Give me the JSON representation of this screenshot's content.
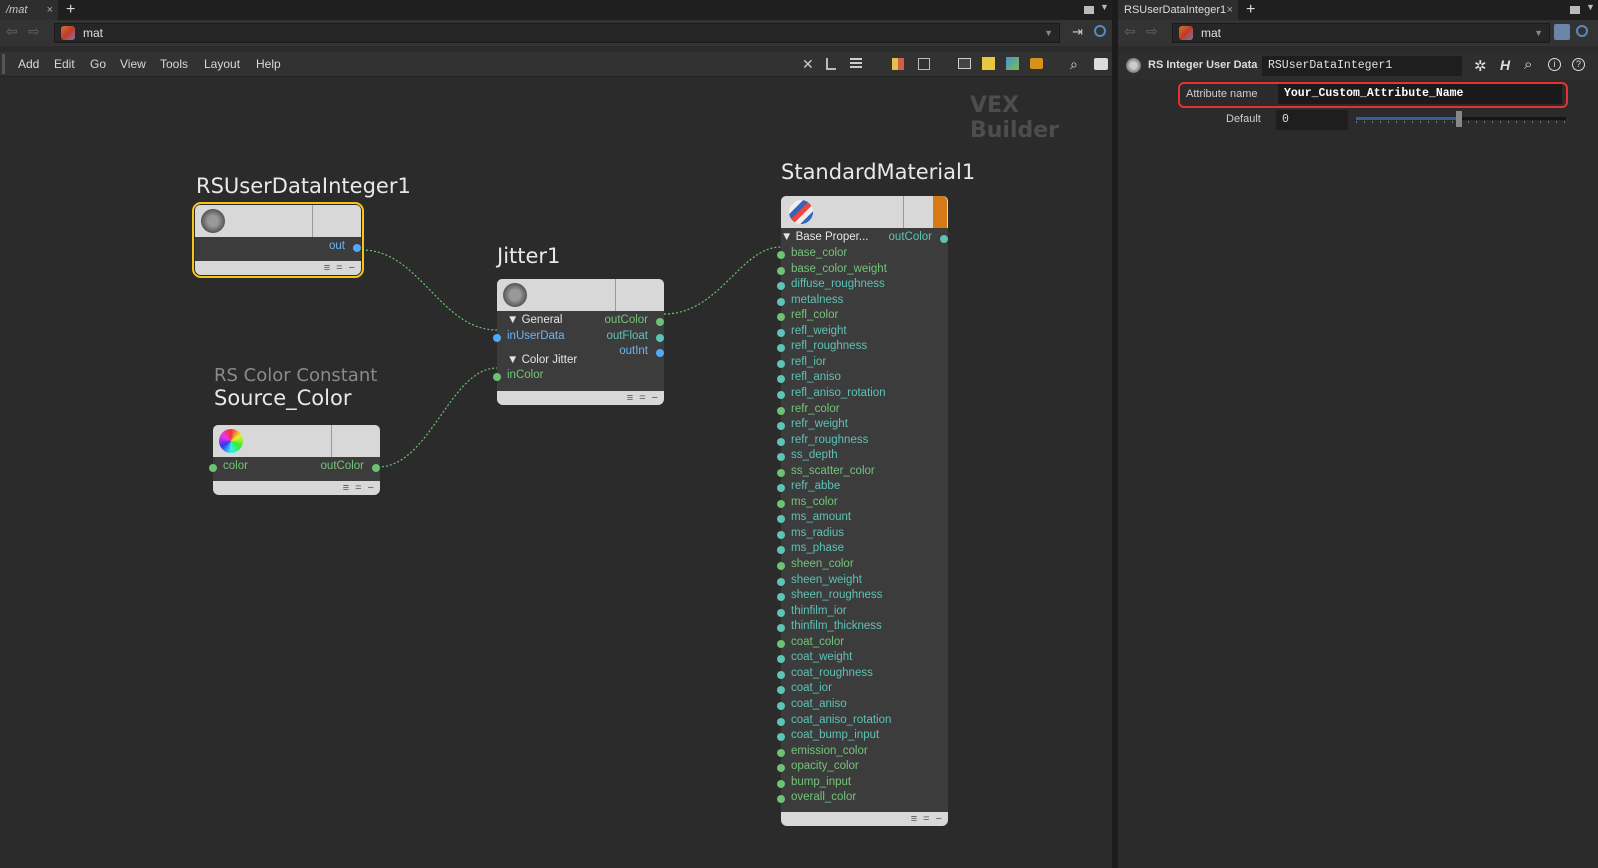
{
  "left": {
    "tab_label": "/mat",
    "path": "mat",
    "menu": [
      "Add",
      "Edit",
      "Go",
      "View",
      "Tools",
      "Layout",
      "Help"
    ],
    "watermark": "VEX Builder",
    "nodes": {
      "userdata": {
        "title": "RSUserDataInteger1",
        "out": "out"
      },
      "jitter": {
        "title": "Jitter1",
        "section_general": "General",
        "in_userdata": "inUserData",
        "out_color": "outColor",
        "out_float": "outFloat",
        "out_int": "outInt",
        "section_color_jitter": "Color Jitter",
        "in_color": "inColor"
      },
      "source": {
        "type_label": "RS Color Constant",
        "title": "Source_Color",
        "in_color": "color",
        "out_color": "outColor"
      },
      "material": {
        "title": "StandardMaterial1",
        "section": "Base Proper...",
        "out_color": "outColor",
        "inputs": [
          "base_color",
          "base_color_weight",
          "diffuse_roughness",
          "metalness",
          "refl_color",
          "refl_weight",
          "refl_roughness",
          "refl_ior",
          "refl_aniso",
          "refl_aniso_rotation",
          "refr_color",
          "refr_weight",
          "refr_roughness",
          "ss_depth",
          "ss_scatter_color",
          "refr_abbe",
          "ms_color",
          "ms_amount",
          "ms_radius",
          "ms_phase",
          "sheen_color",
          "sheen_weight",
          "sheen_roughness",
          "thinfilm_ior",
          "thinfilm_thickness",
          "coat_color",
          "coat_weight",
          "coat_roughness",
          "coat_ior",
          "coat_aniso",
          "coat_aniso_rotation",
          "coat_bump_input",
          "emission_color",
          "opacity_color",
          "bump_input",
          "overall_color"
        ],
        "input_colors": [
          "g",
          "g",
          "t",
          "t",
          "g",
          "t",
          "t",
          "t",
          "t",
          "t",
          "g",
          "t",
          "t",
          "t",
          "g",
          "t",
          "g",
          "t",
          "t",
          "t",
          "g",
          "t",
          "t",
          "t",
          "t",
          "g",
          "t",
          "t",
          "t",
          "t",
          "t",
          "t",
          "g",
          "g",
          "g",
          "g"
        ]
      }
    }
  },
  "right": {
    "tab_label": "RSUserDataInteger1",
    "path": "mat",
    "node_type": "RS Integer User Data",
    "node_name": "RSUserDataInteger1",
    "params": {
      "attr_label": "Attribute name",
      "attr_value": "Your_Custom_Attribute_Name",
      "default_label": "Default",
      "default_value": "0"
    }
  },
  "colors": {
    "selection": "#f5c518",
    "highlight": "#e03434",
    "wire": "#6cc272"
  }
}
